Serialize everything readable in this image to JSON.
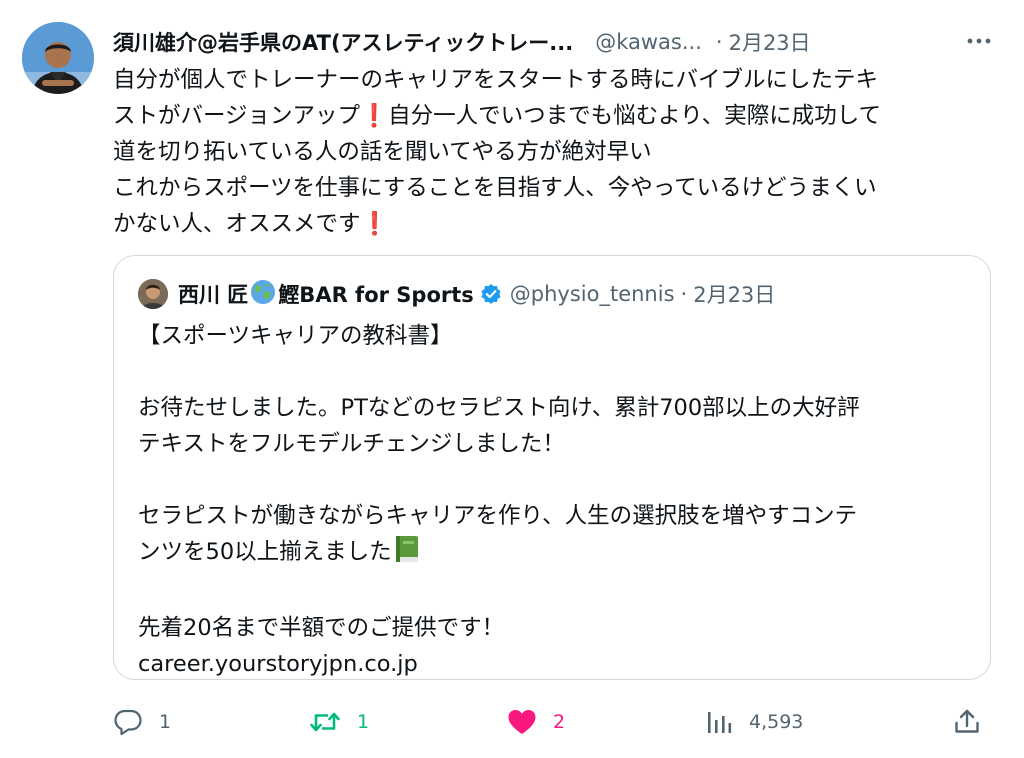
{
  "author": {
    "name": "須川雄介@岩手県のAT(アスレティックトレー...",
    "handle": "@kawas...",
    "date": "2月23日"
  },
  "tweet": {
    "lines": [
      "自分が個人でトレーナーのキャリアをスタートする時にバイブルにしたテキ",
      "ストがバージョンアップ",
      "自分一人でいつまでも悩むより、実際に成功して",
      "道を切り拓いている人の話を聞いてやる方が絶対早い",
      "これからスポーツを仕事にすることを目指す人、今やっているけどうまくい",
      "かない人、オススメです"
    ],
    "exclamation": "❗"
  },
  "quote": {
    "name_part1": "西川 匠",
    "name_part2": "鰹BAR for Sports",
    "handle": "@physio_tennis",
    "dot": "·",
    "date": "2月23日",
    "lines": [
      "【スポーツキャリアの教科書】",
      "お待たせしました。PTなどのセラピスト向け、累計700部以上の大好評",
      "テキストをフルモデルチェンジしました！",
      "セラピストが働きながらキャリアを作り、人生の選択肢を増やすコンテ",
      "ンツを50以上揃えました",
      "先着20名まで半額でのご提供です！",
      "career.yourstoryjpn.co.jp"
    ]
  },
  "actions": {
    "reply_count": "1",
    "retweet_count": "1",
    "like_count": "2",
    "views_count": "4,593"
  },
  "colors": {
    "text": "#0f1419",
    "muted": "#536471",
    "retweet": "#00ba7c",
    "like": "#f91880",
    "verified": "#1d9bf0",
    "border": "#cfd9de"
  },
  "icons": [
    "more-icon",
    "verified-icon",
    "globe-icon",
    "book-icon",
    "reply-icon",
    "retweet-icon",
    "like-icon",
    "views-icon",
    "share-icon"
  ]
}
